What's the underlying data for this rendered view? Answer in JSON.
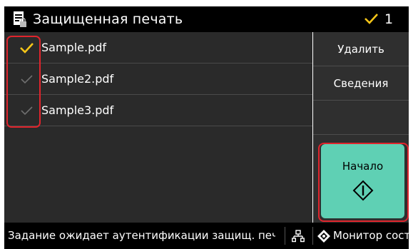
{
  "header": {
    "title": "Защищенная печать",
    "selected_count": "1",
    "icon": "document-lock-icon",
    "check_icon": "checkmark-icon"
  },
  "files": [
    {
      "name": "Sample.pdf",
      "checked": true
    },
    {
      "name": "Sample2.pdf",
      "checked": false
    },
    {
      "name": "Sample3.pdf",
      "checked": false
    }
  ],
  "side": {
    "delete_label": "Удалить",
    "details_label": "Сведения",
    "start_label": "Начало"
  },
  "status": {
    "message": "Задание ожидает аутентификации защищ. печати...",
    "monitor_label": "Монитор сост."
  },
  "colors": {
    "accent_check": "#f5c518",
    "inactive_check": "#6e6e6e",
    "start_button": "#5fd0b4",
    "highlight": "#e0242c",
    "panel": "#2a2a2a",
    "bar": "#000000"
  }
}
